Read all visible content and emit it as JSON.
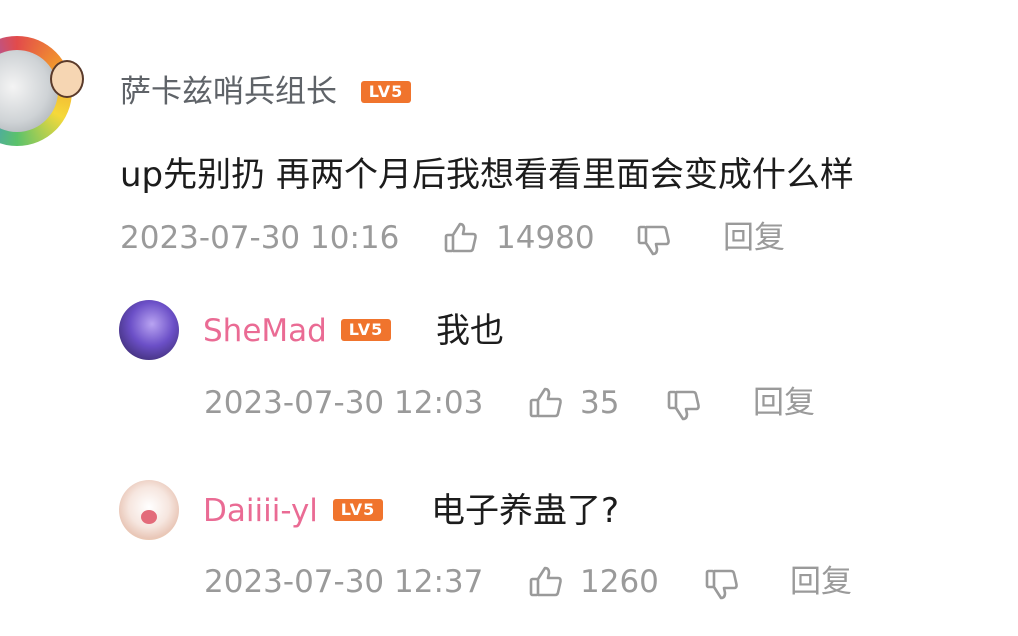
{
  "comments": [
    {
      "username": "萨卡兹哨兵组长",
      "level": "LV5",
      "content": "up先别扔 再两个月后我想看看里面会变成什么样",
      "time": "2023-07-30 10:16",
      "likes": "14980",
      "reply_label": "回复"
    },
    {
      "username": "SheMad",
      "level": "LV5",
      "content": "我也",
      "time": "2023-07-30 12:03",
      "likes": "35",
      "reply_label": "回复"
    },
    {
      "username": "Daiiii-yl",
      "level": "LV5",
      "content": "电子养蛊了?",
      "time": "2023-07-30 12:37",
      "likes": "1260",
      "reply_label": "回复"
    }
  ],
  "colors": {
    "level_badge": "#f0742d",
    "username_pink": "#ea6b94",
    "username_gray": "#5f6368",
    "meta_gray": "#9a9a9a"
  },
  "icons": [
    "thumbs-up-icon",
    "thumbs-down-icon"
  ]
}
